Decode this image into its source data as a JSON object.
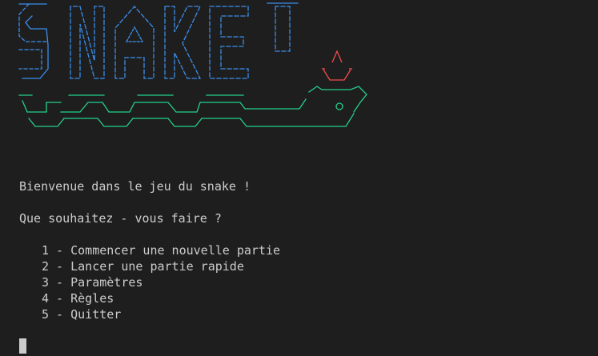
{
  "terminal": {
    "banner_logo_text": "SNAKE !",
    "welcome": "Bienvenue dans le jeu du snake !",
    "question": "Que souhaitez - vous faire ?",
    "menu_items": [
      "1 - Commencer une nouvelle partie",
      "2 - Lancer une partie rapide",
      "3 - Paramètres",
      "4 - Règles",
      "5 - Quitter"
    ],
    "colors": {
      "background": "#1e1e1e",
      "text": "#cccccc",
      "title_blue": "#3b8eea",
      "exclamation_red": "#f14c4c",
      "snake_green": "#23d18b"
    }
  }
}
